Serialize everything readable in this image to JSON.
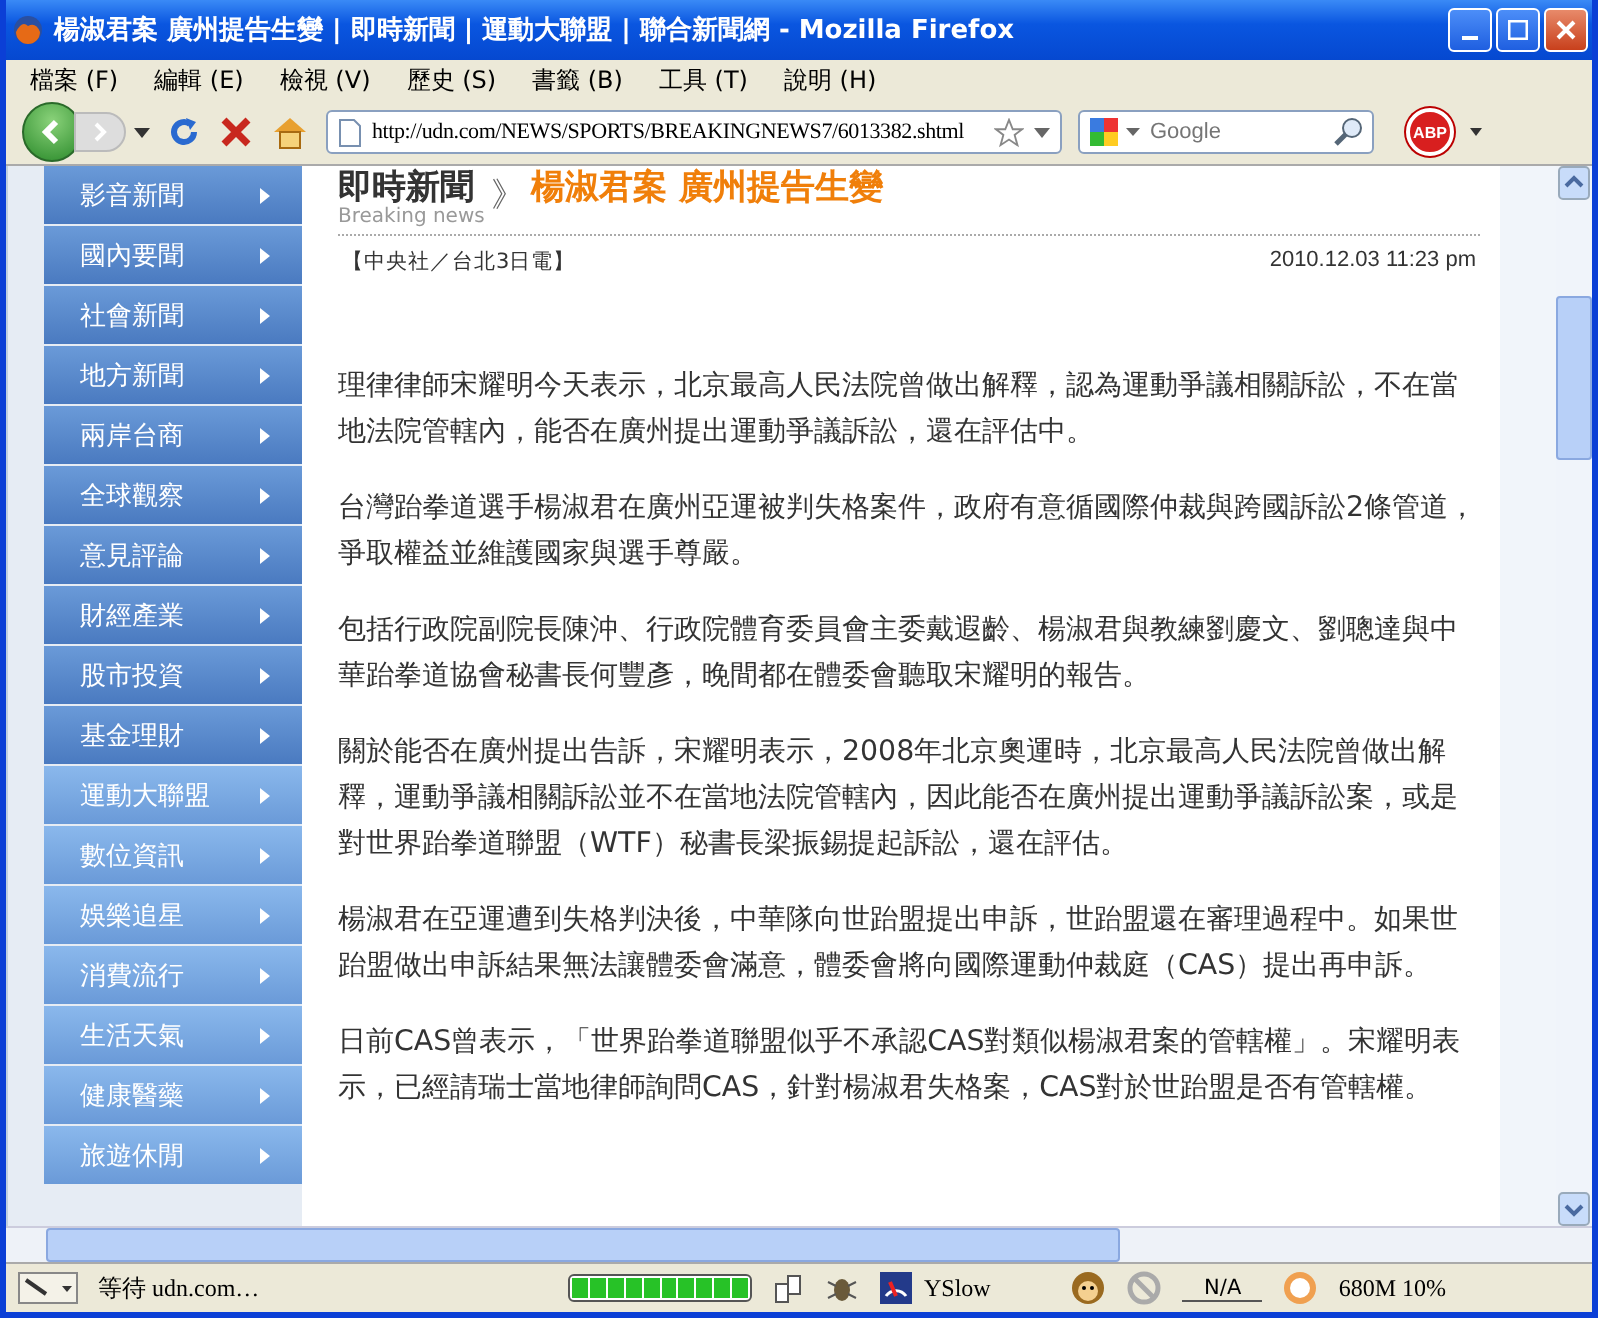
{
  "window": {
    "title": "楊淑君案 廣州提告生變 | 即時新聞 | 運動大聯盟 | 聯合新聞網 - Mozilla Firefox"
  },
  "menu": [
    "檔案 (F)",
    "編輯 (E)",
    "檢視 (V)",
    "歷史 (S)",
    "書籤 (B)",
    "工具 (T)",
    "說明 (H)"
  ],
  "toolbar": {
    "url": "http://udn.com/NEWS/SPORTS/BREAKINGNEWS7/6013382.shtml",
    "search_placeholder": "Google",
    "adblock": "ABP"
  },
  "sidebar": {
    "items": [
      {
        "label": "影音新聞",
        "kind": "dark"
      },
      {
        "label": "國內要聞",
        "kind": "dark"
      },
      {
        "label": "社會新聞",
        "kind": "dark"
      },
      {
        "label": "地方新聞",
        "kind": "dark"
      },
      {
        "label": "兩岸台商",
        "kind": "dark"
      },
      {
        "label": "全球觀察",
        "kind": "dark"
      },
      {
        "label": "意見評論",
        "kind": "dark"
      },
      {
        "label": "財經產業",
        "kind": "dark"
      },
      {
        "label": "股市投資",
        "kind": "dark"
      },
      {
        "label": "基金理財",
        "kind": "dark"
      },
      {
        "label": "運動大聯盟",
        "kind": "light"
      },
      {
        "label": "數位資訊",
        "kind": "light"
      },
      {
        "label": "娛樂追星",
        "kind": "light"
      },
      {
        "label": "消費流行",
        "kind": "light"
      },
      {
        "label": "生活天氣",
        "kind": "light"
      },
      {
        "label": "健康醫藥",
        "kind": "light"
      },
      {
        "label": "旅遊休閒",
        "kind": "light"
      }
    ]
  },
  "article": {
    "section": "即時新聞",
    "section_en": "Breaking news",
    "separator": "》",
    "headline": "楊淑君案 廣州提告生變",
    "source": "【中央社／台北3日電】",
    "datetime": "2010.12.03 11:23 pm",
    "paragraphs": [
      "理律律師宋耀明今天表示，北京最高人民法院曾做出解釋，認為運動爭議相關訴訟，不在當地法院管轄內，能否在廣州提出運動爭議訴訟，還在評估中。",
      "台灣跆拳道選手楊淑君在廣州亞運被判失格案件，政府有意循國際仲裁與跨國訴訟2條管道，爭取權益並維護國家與選手尊嚴。",
      "包括行政院副院長陳沖、行政院體育委員會主委戴遐齡、楊淑君與教練劉慶文、劉聰達與中華跆拳道協會秘書長何豐彥，晚間都在體委會聽取宋耀明的報告。",
      "關於能否在廣州提出告訴，宋耀明表示，2008年北京奧運時，北京最高人民法院曾做出解釋，運動爭議相關訴訟並不在當地法院管轄內，因此能否在廣州提出運動爭議訴訟案，或是對世界跆拳道聯盟（WTF）秘書長梁振錫提起訴訟，還在評估。",
      "楊淑君在亞運遭到失格判決後，中華隊向世跆盟提出申訴，世跆盟還在審理過程中。如果世跆盟做出申訴結果無法讓體委會滿意，體委會將向國際運動仲裁庭（CAS）提出再申訴。",
      "日前CAS曾表示，「世界跆拳道聯盟似乎不承認CAS對類似楊淑君案的管轄權」。宋耀明表示，已經請瑞士當地律師詢問CAS，針對楊淑君失格案，CAS對於世跆盟是否有管轄權。"
    ]
  },
  "status_bar": {
    "text": "等待 udn.com…",
    "progress": {
      "level": 1
    },
    "yslow": "YSlow",
    "na": "N/A",
    "memory": "680M 10%"
  }
}
